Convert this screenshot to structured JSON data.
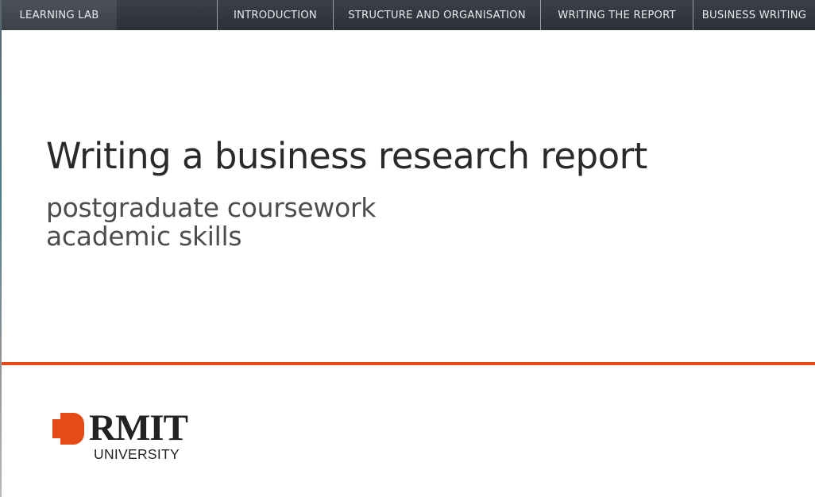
{
  "nav": {
    "home_label": "LEARNING LAB",
    "items": [
      {
        "label": "INTRODUCTION"
      },
      {
        "label": "STRUCTURE AND ORGANISATION"
      },
      {
        "label": "WRITING THE REPORT"
      },
      {
        "label": "BUSINESS WRITING"
      }
    ]
  },
  "slide": {
    "title": "Writing a business research report",
    "subtitle_line1": "postgraduate coursework",
    "subtitle_line2": "academic skills"
  },
  "logo": {
    "wordmark": "RMIT",
    "subtext": "UNIVERSITY",
    "icon": "rmit-pixel-mark-icon"
  },
  "colors": {
    "nav_bg": "#2c3038",
    "accent_rule": "#e64a17",
    "logo_mark": "#e64a17"
  }
}
